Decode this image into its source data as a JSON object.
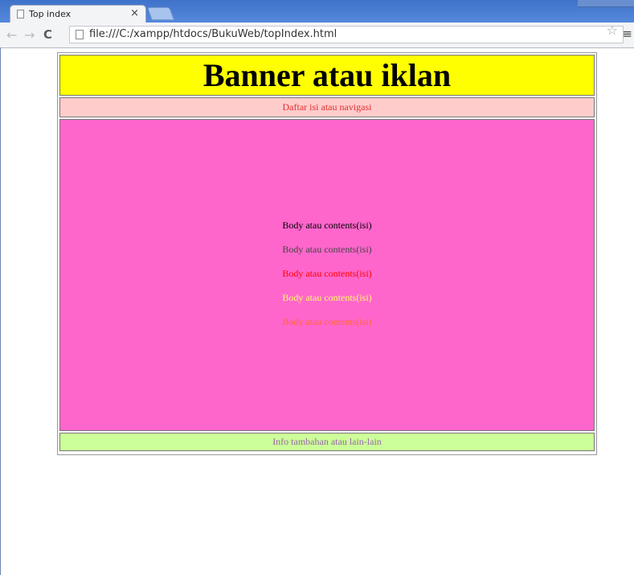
{
  "browser": {
    "tab_title": "Top index",
    "tab_close": "×",
    "url": "file:///C:/xampp/htdocs/BukuWeb/topIndex.html",
    "back": "←",
    "forward": "→",
    "reload": "C",
    "star": "☆",
    "menu": "≡"
  },
  "page": {
    "banner": "Banner atau iklan",
    "nav": "Daftar isi atau navigasi",
    "content_lines": [
      {
        "text": "Body atau contents(isi)",
        "color": "#000000"
      },
      {
        "text": "Body atau contents(isi)",
        "color": "#444444"
      },
      {
        "text": "Body atau contents(isi)",
        "color": "#ff0000"
      },
      {
        "text": "Body atau contents(isi)",
        "color": "#ffff66"
      },
      {
        "text": "Body atau contents(isi)",
        "color": "#ff6633"
      }
    ],
    "footer": "Info tambahan atau lain-lain",
    "colors": {
      "banner_bg": "#ffff00",
      "nav_bg": "#ffcccc",
      "content_bg": "#ff66cc",
      "footer_bg": "#ccff99"
    }
  }
}
